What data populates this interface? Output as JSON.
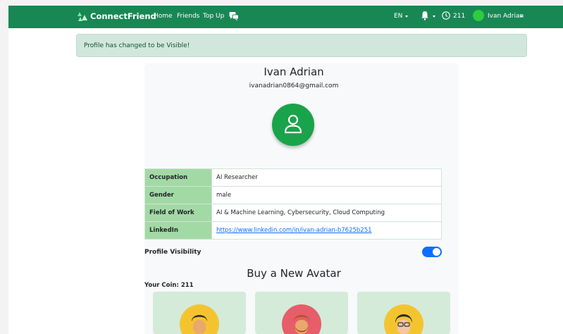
{
  "navbar": {
    "brand": "ConnectFriend",
    "links": [
      "Home",
      "Friends",
      "Top Up"
    ],
    "icons": {
      "chat": "chat-icon",
      "bell": "bell-icon",
      "coin": "coin-icon"
    },
    "language": "EN",
    "coins": "211",
    "user_name": "Ivan Adrian",
    "bg_color": "#198754"
  },
  "alert": {
    "message": "Profile has changed to be Visible!"
  },
  "profile": {
    "name": "Ivan Adrian",
    "email": "ivanadrian0864@gmail.com",
    "avatar_icon": "user-icon",
    "rows": [
      {
        "label": "Occupation",
        "value": "AI Researcher"
      },
      {
        "label": "Gender",
        "value": "male"
      },
      {
        "label": "Field of Work",
        "value": "AI & Machine Learning, Cybersecurity, Cloud Computing"
      },
      {
        "label": "LinkedIn",
        "value": "https://www.linkedin.com/in/ivan-adrian-b7625b251"
      }
    ],
    "visibility_label": "Profile Visibility",
    "visibility_on": true
  },
  "shop": {
    "title": "Buy a New Avatar",
    "coin_label": "Your Coin: 211",
    "colors": [
      "#f4c430",
      "#e65e6a",
      "#f4c430"
    ]
  }
}
